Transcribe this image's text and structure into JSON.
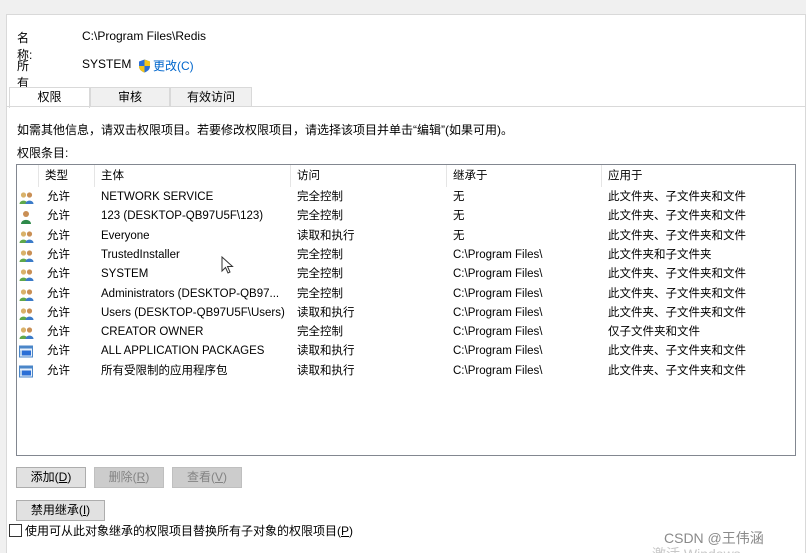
{
  "owner_section": {
    "name_label": "名称:",
    "name_value": "C:\\Program Files\\Redis",
    "owner_label": "所有者:",
    "owner_value": "SYSTEM",
    "change_link": "更改(C)"
  },
  "tabs": [
    {
      "label": "权限",
      "active": true
    },
    {
      "label": "审核",
      "active": false
    },
    {
      "label": "有效访问",
      "active": false
    }
  ],
  "hint_text": "如需其他信息，请双击权限项目。若要修改权限项目，请选择该项目并单击“编辑”(如果可用)。",
  "entries_label": "权限条目:",
  "table": {
    "columns": [
      "类型",
      "主体",
      "访问",
      "继承于",
      "应用于"
    ],
    "rows": [
      {
        "icon": "group-icon",
        "type": "允许",
        "principal": "NETWORK SERVICE",
        "access": "完全控制",
        "inherited_from": "无",
        "applies_to": "此文件夹、子文件夹和文件"
      },
      {
        "icon": "user-icon",
        "type": "允许",
        "principal": "123 (DESKTOP-QB97U5F\\123)",
        "access": "完全控制",
        "inherited_from": "无",
        "applies_to": "此文件夹、子文件夹和文件"
      },
      {
        "icon": "group-icon",
        "type": "允许",
        "principal": "Everyone",
        "access": "读取和执行",
        "inherited_from": "无",
        "applies_to": "此文件夹、子文件夹和文件"
      },
      {
        "icon": "group-icon",
        "type": "允许",
        "principal": "TrustedInstaller",
        "access": "完全控制",
        "inherited_from": "C:\\Program Files\\",
        "applies_to": "此文件夹和子文件夹"
      },
      {
        "icon": "group-icon",
        "type": "允许",
        "principal": "SYSTEM",
        "access": "完全控制",
        "inherited_from": "C:\\Program Files\\",
        "applies_to": "此文件夹、子文件夹和文件"
      },
      {
        "icon": "group-icon",
        "type": "允许",
        "principal": "Administrators (DESKTOP-QB97...",
        "access": "完全控制",
        "inherited_from": "C:\\Program Files\\",
        "applies_to": "此文件夹、子文件夹和文件"
      },
      {
        "icon": "group-icon",
        "type": "允许",
        "principal": "Users (DESKTOP-QB97U5F\\Users)",
        "access": "读取和执行",
        "inherited_from": "C:\\Program Files\\",
        "applies_to": "此文件夹、子文件夹和文件"
      },
      {
        "icon": "group-icon",
        "type": "允许",
        "principal": "CREATOR OWNER",
        "access": "完全控制",
        "inherited_from": "C:\\Program Files\\",
        "applies_to": "仅子文件夹和文件"
      },
      {
        "icon": "app-package-icon",
        "type": "允许",
        "principal": "ALL APPLICATION PACKAGES",
        "access": "读取和执行",
        "inherited_from": "C:\\Program Files\\",
        "applies_to": "此文件夹、子文件夹和文件"
      },
      {
        "icon": "app-package-icon",
        "type": "允许",
        "principal": "所有受限制的应用程序包",
        "access": "读取和执行",
        "inherited_from": "C:\\Program Files\\",
        "applies_to": "此文件夹、子文件夹和文件"
      }
    ]
  },
  "buttons": {
    "add": {
      "label": "添加",
      "key": "D",
      "enabled": true
    },
    "remove": {
      "label": "删除",
      "key": "R",
      "enabled": false
    },
    "view": {
      "label": "查看",
      "key": "V",
      "enabled": false
    },
    "disable_inheritance": {
      "label": "禁用继承",
      "key": "I",
      "enabled": true
    }
  },
  "replace_checkbox": {
    "label": "使用可从此对象继承的权限项目替换所有子对象的权限项目",
    "key": "P",
    "checked": false
  },
  "watermark": "CSDN @王伟涵",
  "watermark_partial": "激活 Windows",
  "colors": {
    "link": "#0066cc",
    "list_border": "#828790",
    "button_bg": "#e1e1e1",
    "button_disabled_bg": "#cccccc"
  }
}
